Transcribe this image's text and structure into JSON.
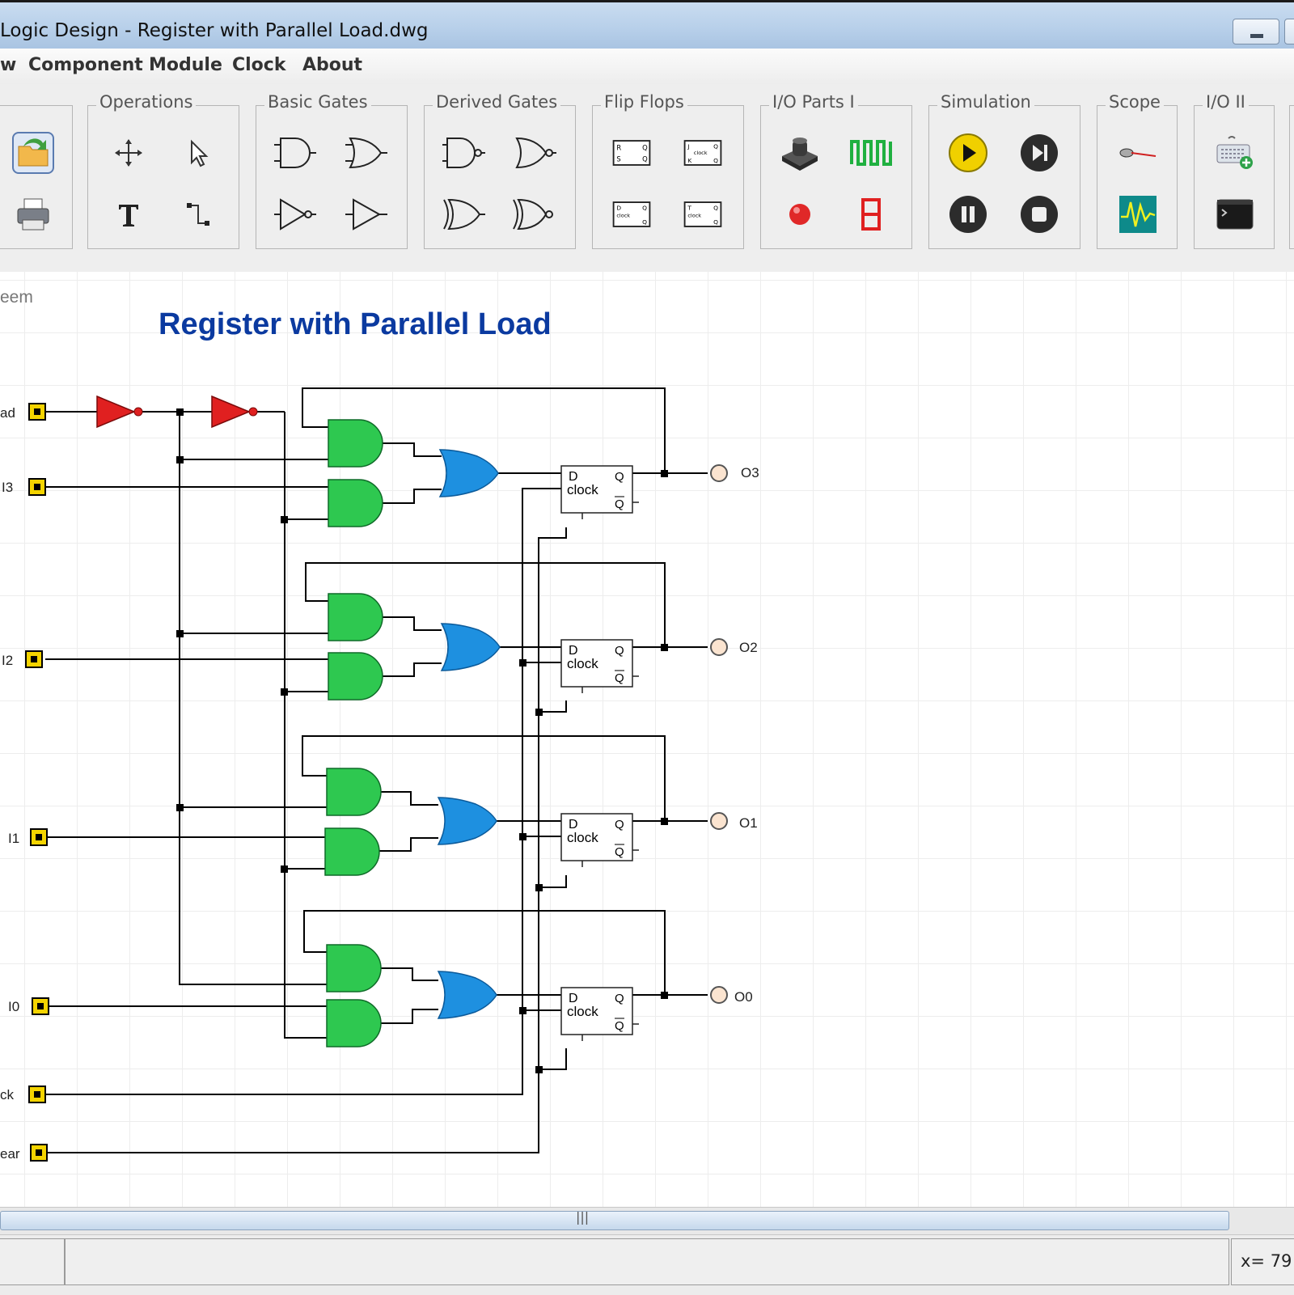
{
  "window": {
    "title": "Logic Design - Register with Parallel Load.dwg"
  },
  "menu": [
    "w",
    "Component",
    "Module",
    "Clock",
    "About"
  ],
  "toolbar": {
    "groups": [
      "Operations",
      "Basic Gates",
      "Derived Gates",
      "Flip Flops",
      "I/O Parts I",
      "Simulation",
      "Scope",
      "I/O II"
    ]
  },
  "canvas": {
    "corner_text": "eem",
    "title": "Register with Parallel Load",
    "inputs": [
      "ad",
      "I3",
      "I2",
      "I1",
      "I0",
      "ck",
      "ear"
    ],
    "outputs": [
      "O3",
      "O2",
      "O1",
      "O0"
    ],
    "ff_labels": {
      "d": "D",
      "clock": "clock",
      "q": "Q",
      "qbar": "Q"
    },
    "colors": {
      "title": "#0b3aa0",
      "not_gate": "#e02020",
      "and_gate": "#2ec850",
      "or_gate": "#1e90e0",
      "wire": "#000000"
    }
  },
  "status": {
    "coord": "x= 79"
  }
}
